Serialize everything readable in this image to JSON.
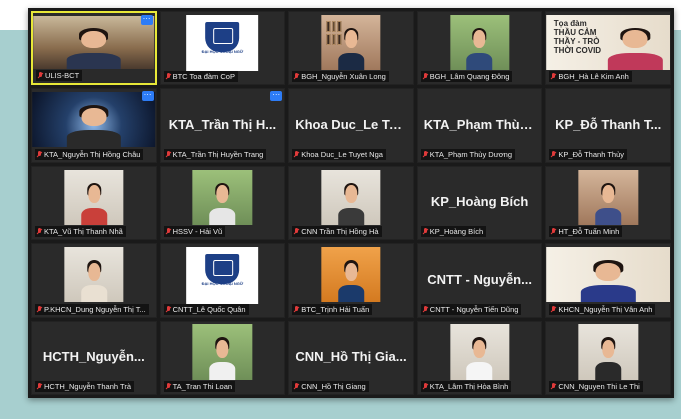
{
  "participants": [
    {
      "label": "ULIS-BCT",
      "kind": "video",
      "bg": "room",
      "shirt": "#2a3550",
      "active": true,
      "badge": true
    },
    {
      "label": "BTC Toa đàm CoP",
      "kind": "logo",
      "bg": "logo-bg",
      "logo_caption": "ĐẠI HỌC NGOẠI NGỮ"
    },
    {
      "label": "BGH_Nguyễn Xuân Long",
      "kind": "video",
      "bg": "wall-warm",
      "shirt": "#1b2a44",
      "frames": true
    },
    {
      "label": "BGH_Lâm Quang Đông",
      "kind": "video",
      "bg": "green-bg",
      "shirt": "#2f4a7a"
    },
    {
      "label": "BGH_Hà Lê Kim Anh",
      "kind": "poster",
      "bg": "poster-bg",
      "shirt": "#c0395a",
      "poster_text": "Tọa đàm\nTHẦU CẢM\nTHẦY - TRÒ\nTHỜI COVID"
    },
    {
      "label": "KTA_Nguyễn Thị Hồng Châu",
      "kind": "video",
      "bg": "space",
      "shirt": "#2a2a2a",
      "badge": true
    },
    {
      "label": "KTA_Trần Thị Huyền Trang",
      "kind": "name",
      "name_text": "KTA_Trần Thị H...",
      "badge": true
    },
    {
      "label": "Khoa Duc_Le Tuyet Nga",
      "kind": "name",
      "name_text": "Khoa Duc_Le Tu..."
    },
    {
      "label": "KTA_Phạm Thùy Dương",
      "kind": "name",
      "name_text": "KTA_Phạm Thùy..."
    },
    {
      "label": "KP_Đỗ Thanh Thủy",
      "kind": "name",
      "name_text": "KP_Đỗ Thanh T..."
    },
    {
      "label": "KTA_Vũ Thị Thanh Nhã",
      "kind": "video",
      "bg": "indoor-light",
      "shirt": "#c9403a"
    },
    {
      "label": "HSSV - Hải Vũ",
      "kind": "video",
      "bg": "green-bg",
      "shirt": "#e6e6e6"
    },
    {
      "label": "CNN Trần Thị Hồng Hà",
      "kind": "video",
      "bg": "indoor-light",
      "shirt": "#3a3a3a"
    },
    {
      "label": "KP_Hoàng Bích",
      "kind": "name",
      "name_text": "KP_Hoàng Bích"
    },
    {
      "label": "HT_Đỗ Tuấn Minh",
      "kind": "video",
      "bg": "wall-warm",
      "shirt": "#3e4f8a"
    },
    {
      "label": "P.KHCN_Dung Nguyễn Thị T...",
      "kind": "video",
      "bg": "indoor-light",
      "shirt": "#e9e0d2"
    },
    {
      "label": "CNTT_Lê Quốc Quân",
      "kind": "logo",
      "bg": "logo-bg",
      "logo_caption": "ĐẠI HỌC NGOẠI NGỮ"
    },
    {
      "label": "BTC_Trịnh Hải Tuấn",
      "kind": "video",
      "bg": "orange-bg",
      "shirt": "#1b3a6b"
    },
    {
      "label": "CNTT - Nguyễn Tiến Dũng",
      "kind": "name",
      "name_text": "CNTT - Nguyễn..."
    },
    {
      "label": "KHCN_Nguyễn Thị Vân Anh",
      "kind": "video",
      "bg": "poster-bg",
      "shirt": "#2a3a8a"
    },
    {
      "label": "HCTH_Nguyễn Thanh Trà",
      "kind": "name",
      "name_text": "HCTH_Nguyễn..."
    },
    {
      "label": "TA_Tran Thi Loan",
      "kind": "video",
      "bg": "green-bg",
      "shirt": "#f0f0f0"
    },
    {
      "label": "CNN_Hồ Thị Giang",
      "kind": "name",
      "name_text": "CNN_Hồ Thị Gia..."
    },
    {
      "label": "KTA_Lâm Thị Hòa Bình",
      "kind": "video",
      "bg": "indoor-light",
      "shirt": "#f5f5f5"
    },
    {
      "label": "CNN_Nguyen Thi Le Thi",
      "kind": "video",
      "bg": "indoor-light",
      "shirt": "#2a2a2a"
    }
  ],
  "colors": {
    "active_border": "#e8e838",
    "muted_mic": "#e03a3a",
    "badge": "#2d7cf6",
    "background_teal": "#a7cfcf",
    "window": "#1a1a1a"
  },
  "icons": {
    "mic": "muted-mic-icon",
    "more": "more-options-icon"
  }
}
